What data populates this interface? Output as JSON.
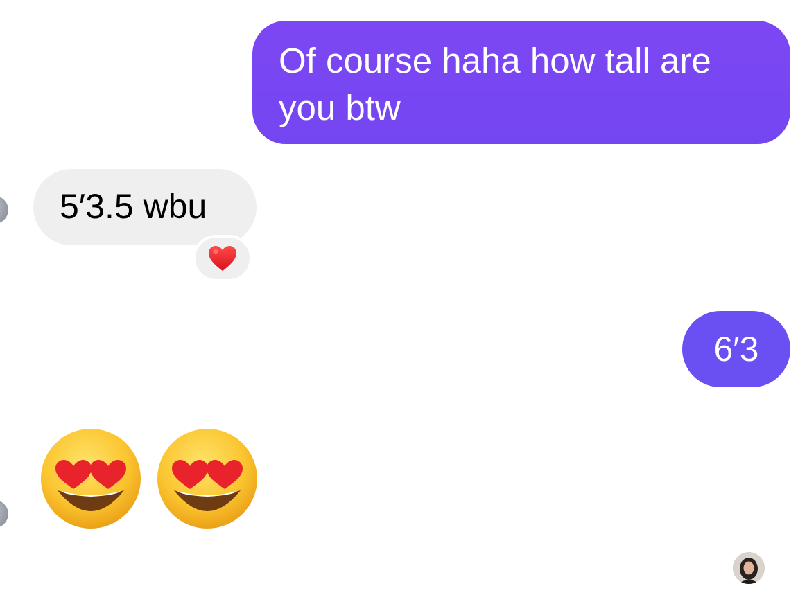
{
  "messages": [
    {
      "direction": "outgoing",
      "text": "Of course haha how tall are you btw"
    },
    {
      "direction": "incoming",
      "text": "5′3.5 wbu",
      "reaction": "heart"
    },
    {
      "direction": "outgoing",
      "text": "6′3"
    },
    {
      "direction": "incoming",
      "emoji": [
        "heart-eyes",
        "heart-eyes"
      ]
    }
  ],
  "colors": {
    "outgoing_bubble": "#7c47f3",
    "outgoing_bubble_2": "#6a4ff2",
    "incoming_bubble": "#efefef",
    "heart": "#e6212b"
  },
  "icons": {
    "reaction": "heart-icon",
    "emoji": "heart-eyes-emoji-icon",
    "read_receipt": "avatar-icon"
  }
}
